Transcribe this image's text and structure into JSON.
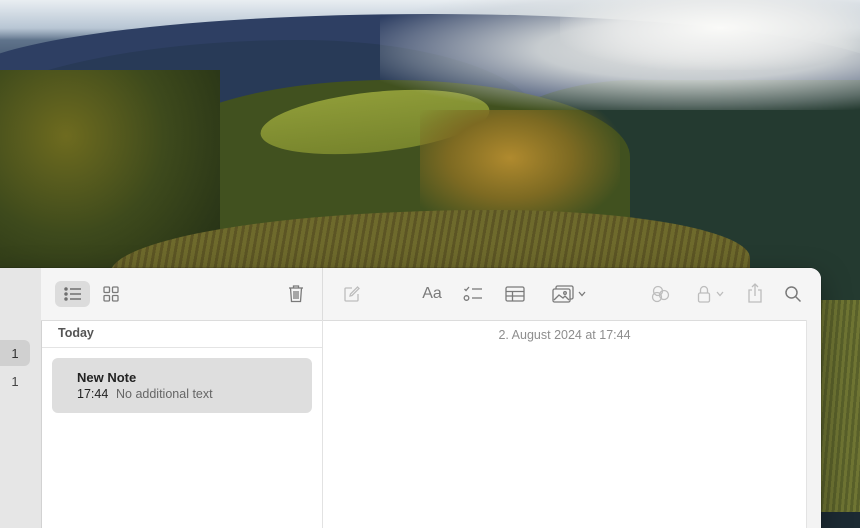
{
  "colors": {
    "window_bg": "#ffffff",
    "toolbar_bg": "#f5f5f5",
    "selection": "#dedede",
    "icon": "#7a7a7a",
    "icon_disabled": "#b9b9b9"
  },
  "folders": {
    "counts": [
      "1",
      "1"
    ],
    "selected_index": 0
  },
  "toolbar": {
    "left": [
      {
        "name": "list-view-icon",
        "active": true
      },
      {
        "name": "gallery-view-icon",
        "active": false
      },
      {
        "name": "trash-icon",
        "active": false
      }
    ],
    "right": [
      {
        "name": "compose-icon",
        "enabled": false
      },
      {
        "name": "format-text-icon",
        "label": "Aa"
      },
      {
        "name": "checklist-icon"
      },
      {
        "name": "table-icon"
      },
      {
        "name": "media-icon",
        "has_dropdown": true
      },
      {
        "name": "collaborate-icon",
        "enabled": false
      },
      {
        "name": "lock-icon",
        "enabled": false,
        "has_dropdown": true
      },
      {
        "name": "share-icon",
        "enabled": false
      },
      {
        "name": "search-icon"
      }
    ]
  },
  "notes_list": {
    "section_title": "Today",
    "items": [
      {
        "title": "New Note",
        "time": "17:44",
        "preview": "No additional text",
        "selected": true
      }
    ]
  },
  "editor": {
    "date_line": "2. August 2024 at 17:44"
  }
}
